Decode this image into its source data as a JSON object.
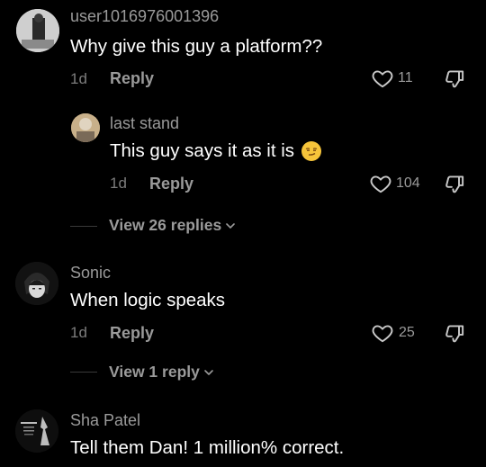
{
  "comments": [
    {
      "username": "user1016976001396",
      "text": "Why give this guy a platform??",
      "time": "1d",
      "reply_label": "Reply",
      "likes": "11",
      "avatar_icon": "profile-photo-icon"
    },
    {
      "username": "last stand",
      "text": "This guy says it as it is",
      "emoji": "smirking-face-emoji",
      "time": "1d",
      "reply_label": "Reply",
      "likes": "104",
      "avatar_icon": "profile-photo-icon"
    },
    {
      "username": "Sonic",
      "text": "When logic speaks",
      "time": "1d",
      "reply_label": "Reply",
      "likes": "25",
      "avatar_icon": "anime-avatar-icon"
    },
    {
      "username": "Sha Patel",
      "text": "Tell them Dan! 1 million% correct.",
      "avatar_icon": "logo-avatar-icon"
    }
  ],
  "view_replies": [
    {
      "label": "View 26 replies"
    },
    {
      "label": "View 1 reply"
    }
  ],
  "colors": {
    "background": "#000000",
    "primary_text": "#ffffff",
    "secondary_text": "#9a9a9a",
    "emoji": "#f6c43a"
  }
}
